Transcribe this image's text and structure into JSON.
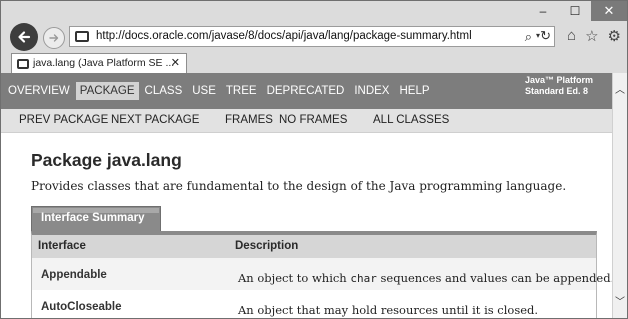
{
  "window": {
    "minimize": "–",
    "maximize": "☐",
    "close": "✕"
  },
  "addressbar": {
    "url": "http://docs.oracle.com/javase/8/docs/api/java/lang/package-summary.html",
    "search_icon": "⌕",
    "dropdown": "▾",
    "refresh_icon": "↻"
  },
  "tools": {
    "home": "⌂",
    "favorites": "☆",
    "settings": "⚙"
  },
  "tab": {
    "label": "java.lang (Java Platform SE ...",
    "close": "✕"
  },
  "topnav": {
    "items": [
      "OVERVIEW",
      "PACKAGE",
      "CLASS",
      "USE",
      "TREE",
      "DEPRECATED",
      "INDEX",
      "HELP"
    ],
    "active": "PACKAGE",
    "brand_line1": "Java™ Platform",
    "brand_line2": "Standard Ed. 8"
  },
  "subnav": {
    "prev": "PREV PACKAGE",
    "next": "NEXT PACKAGE",
    "frames": "FRAMES",
    "noframes": "NO FRAMES",
    "allclasses": "ALL CLASSES"
  },
  "page": {
    "title": "Package java.lang",
    "description": "Provides classes that are fundamental to the design of the Java programming language."
  },
  "summary": {
    "caption": "Interface Summary",
    "col_interface": "Interface",
    "col_description": "Description",
    "rows": [
      {
        "name": "Appendable",
        "desc_pre": "An object to which ",
        "desc_code": "char",
        "desc_post": " sequences and values can be appended."
      },
      {
        "name": "AutoCloseable",
        "desc_pre": "An object that may hold resources until it is closed.",
        "desc_code": "",
        "desc_post": ""
      }
    ]
  },
  "scrollbar": {
    "up": "︿",
    "down": "﹀"
  }
}
